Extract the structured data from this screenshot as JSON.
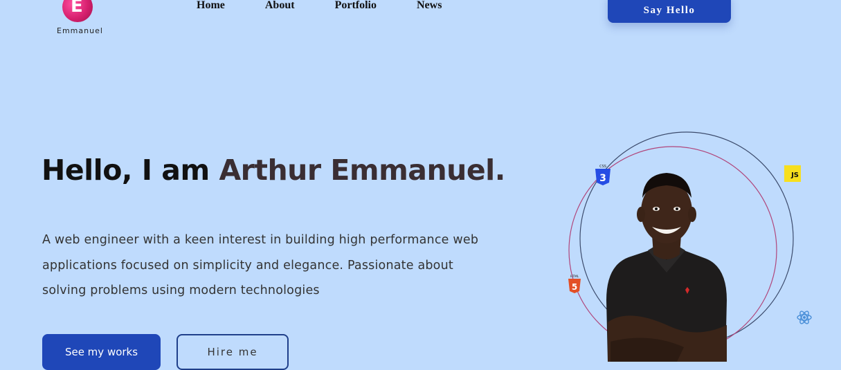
{
  "brand": {
    "logo_letter": "E",
    "name": "Emmanuel"
  },
  "nav": {
    "items": [
      "Home",
      "About",
      "Portfolio",
      "News"
    ]
  },
  "header": {
    "cta": "Say Hello"
  },
  "hero": {
    "greeting": "Hello, I am ",
    "name": "Arthur Emmanuel.",
    "bio": "A web engineer with a keen interest in building high performance web applications focused on simplicity and elegance. Passionate about solving problems using modern technologies",
    "primary_button": "See my works",
    "secondary_button": "Hire me"
  },
  "tech_icons": {
    "css": {
      "label": "CSS",
      "digit": "3"
    },
    "js": {
      "label": "JS"
    },
    "html": {
      "label": "HTML",
      "digit": "5"
    },
    "react": {
      "label": "react-icon"
    }
  },
  "colors": {
    "background": "#bfdbfd",
    "accent": "#1f47b8",
    "logo": "#d6206e",
    "name_text": "#3a2e33"
  }
}
